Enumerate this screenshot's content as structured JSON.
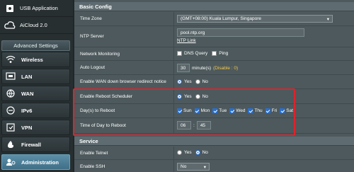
{
  "sidebar": {
    "top_items": [
      {
        "label": "USB Application",
        "icon": "usb-puzzle-icon"
      },
      {
        "label": "AiCloud 2.0",
        "icon": "cloud-icon"
      }
    ],
    "advanced_header": "Advanced Settings",
    "items": [
      {
        "label": "Wireless",
        "icon": "wifi-icon"
      },
      {
        "label": "LAN",
        "icon": "lan-icon"
      },
      {
        "label": "WAN",
        "icon": "globe-icon"
      },
      {
        "label": "IPv6",
        "icon": "ipv6-icon"
      },
      {
        "label": "VPN",
        "icon": "vpn-icon"
      },
      {
        "label": "Firewall",
        "icon": "firewall-icon"
      },
      {
        "label": "Administration",
        "icon": "admin-icon"
      }
    ]
  },
  "basic_config": {
    "title": "Basic Config",
    "time_zone": {
      "label": "Time Zone",
      "value": "(GMT+08:00) Kuala Lumpur, Singapore"
    },
    "ntp_server": {
      "label": "NTP Server",
      "value": "pool.ntp.org",
      "link": "NTP Link"
    },
    "network_monitoring": {
      "label": "Network Monitoring",
      "options": [
        "DNS Query",
        "Ping"
      ]
    },
    "auto_logout": {
      "label": "Auto Logout",
      "value": "30",
      "unit": "minute(s)",
      "note": "(Disable : 0)"
    },
    "wan_redirect": {
      "label": "Enable WAN down browser redirect notice",
      "yes": "Yes",
      "no": "No"
    },
    "reboot_scheduler": {
      "label": "Enable Reboot Scheduler",
      "yes": "Yes",
      "no": "No"
    },
    "days_to_reboot": {
      "label": "Day(s) to Reboot",
      "days": [
        "Sun",
        "Mon",
        "Tue",
        "Wed",
        "Thu",
        "Fri",
        "Sat"
      ]
    },
    "time_of_day": {
      "label": "Time of Day to Reboot",
      "hour": "06",
      "separator": ":",
      "minute": "45"
    }
  },
  "service": {
    "title": "Service",
    "telnet": {
      "label": "Enable Telnet",
      "yes": "Yes",
      "no": "No"
    },
    "ssh": {
      "label": "Enable SSH",
      "value": "No"
    }
  },
  "colors": {
    "highlight": "#e0222a",
    "accent": "#2a6fcc"
  }
}
